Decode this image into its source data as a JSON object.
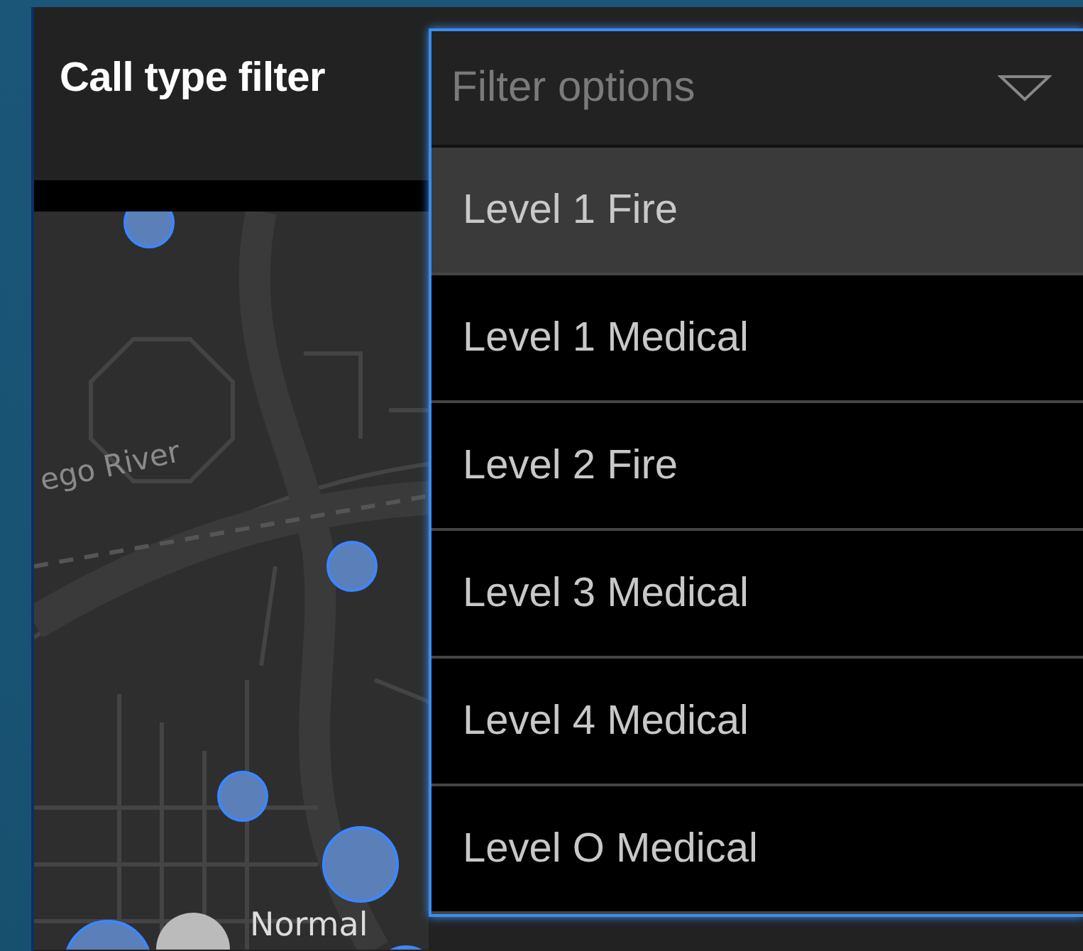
{
  "panel": {
    "title": "Call type filter"
  },
  "dropdown": {
    "placeholder": "Filter options",
    "options": [
      {
        "label": "Level 1 Fire",
        "highlighted": true
      },
      {
        "label": "Level 1 Medical",
        "highlighted": false
      },
      {
        "label": "Level 2 Fire",
        "highlighted": false
      },
      {
        "label": "Level 3 Medical",
        "highlighted": false
      },
      {
        "label": "Level 4 Medical",
        "highlighted": false
      },
      {
        "label": "Level O Medical",
        "highlighted": false
      }
    ]
  },
  "map": {
    "labels": [
      {
        "kind": "river",
        "text": "ego River"
      },
      {
        "kind": "legend",
        "text": "Normal"
      }
    ]
  }
}
